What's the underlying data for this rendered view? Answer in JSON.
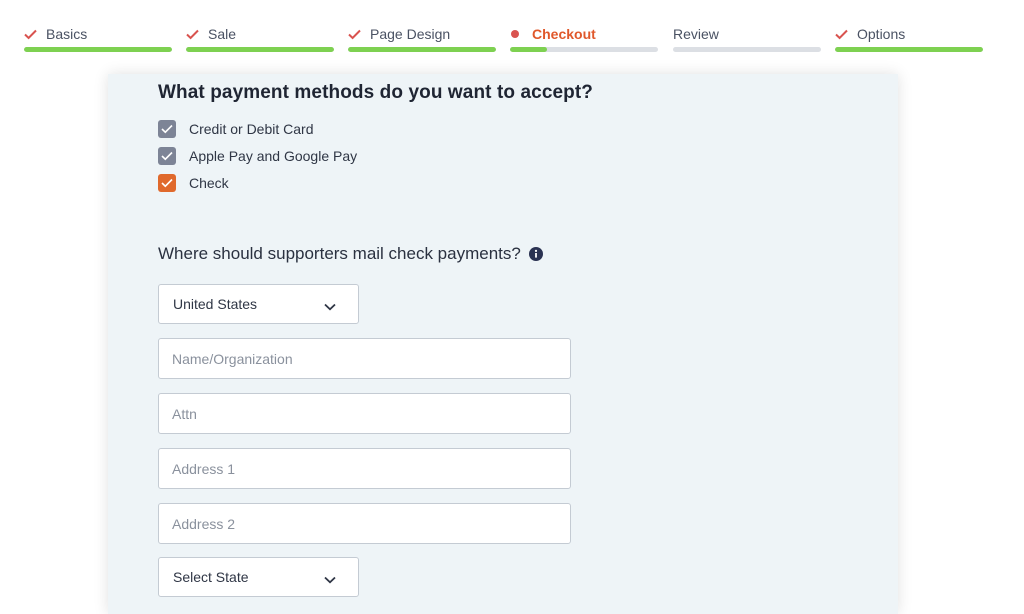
{
  "stepper": {
    "steps": [
      {
        "label": "Basics",
        "status": "complete",
        "progress": 1.0
      },
      {
        "label": "Sale",
        "status": "complete",
        "progress": 1.0
      },
      {
        "label": "Page Design",
        "status": "complete",
        "progress": 1.0
      },
      {
        "label": "Checkout",
        "status": "active",
        "progress": 0.25
      },
      {
        "label": "Review",
        "status": "pending",
        "progress": 0.0
      },
      {
        "label": "Options",
        "status": "complete",
        "progress": 1.0
      }
    ],
    "colors": {
      "complete": "#7ed151",
      "active": "#e0582b",
      "check": "#d9534f",
      "pending": "#dcdfe4"
    }
  },
  "payment": {
    "question": "What payment methods do you want to accept?",
    "options": [
      {
        "label": "Credit or Debit Card",
        "checked": true,
        "color": "#7d8496"
      },
      {
        "label": "Apple Pay and Google Pay",
        "checked": true,
        "color": "#7d8496"
      },
      {
        "label": "Check",
        "checked": true,
        "color": "#e0692c"
      }
    ]
  },
  "mailing": {
    "question": "Where should supporters mail check payments?",
    "info_icon": "info-circle-icon",
    "country": "United States",
    "name_placeholder": "Name/Organization",
    "attn_placeholder": "Attn",
    "address1_placeholder": "Address 1",
    "address2_placeholder": "Address 2",
    "state": "Select State"
  }
}
